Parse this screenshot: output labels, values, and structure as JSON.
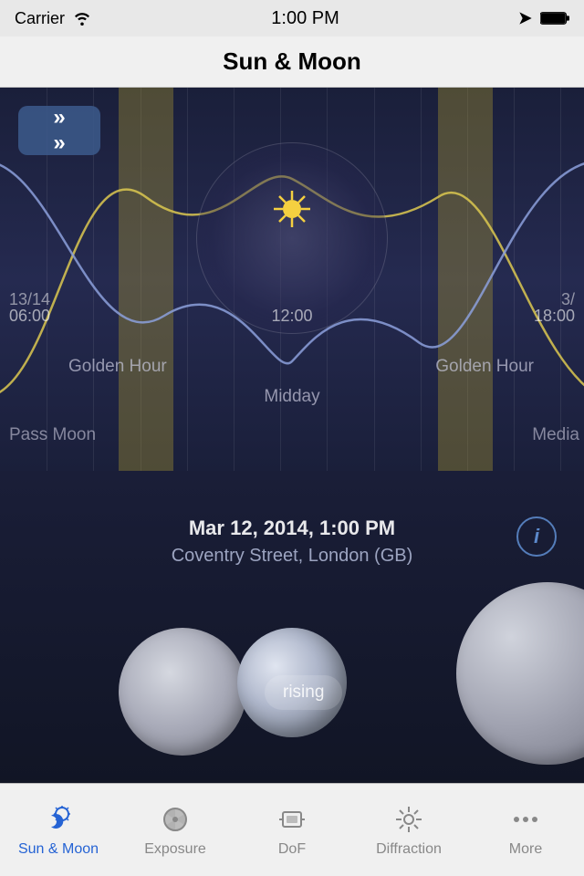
{
  "statusBar": {
    "carrier": "Carrier",
    "time": "1:00 PM",
    "battery": "100"
  },
  "navBar": {
    "title": "Sun & Moon"
  },
  "timeline": {
    "timeLabels": [
      "06:00",
      "12:00",
      "18:00"
    ],
    "dateLabels": [
      "13/14",
      "3/"
    ],
    "goldenHourLeft": "Golden Hour",
    "goldenHourRight": "Golden Hour",
    "midday": "Midday",
    "passMoon": "Pass Moon",
    "media": "Media"
  },
  "info": {
    "dateTime": "Mar 12, 2014, 1:00 PM",
    "location": "Coventry Street, London (GB)"
  },
  "moonWidget": {
    "risingLabel": "rising"
  },
  "tabBar": {
    "tabs": [
      {
        "id": "sun-moon",
        "label": "Sun & Moon",
        "active": true
      },
      {
        "id": "exposure",
        "label": "Exposure",
        "active": false
      },
      {
        "id": "dof",
        "label": "DoF",
        "active": false
      },
      {
        "id": "diffraction",
        "label": "Diffraction",
        "active": false
      },
      {
        "id": "more",
        "label": "More",
        "active": false
      }
    ]
  }
}
